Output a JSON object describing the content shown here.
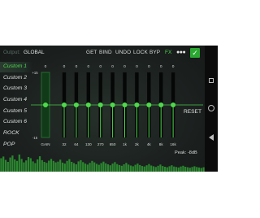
{
  "topbar": {
    "output_label": "Output:",
    "output_value": "GLOBAL",
    "commands": [
      "GET",
      "BIND",
      "UNDO",
      "LOCK",
      "BYP",
      "FX"
    ],
    "more_icon": "more-dots-icon",
    "confirm_icon": "checkmark-icon"
  },
  "presets": [
    "Custom 1",
    "Custom 2",
    "Custom 3",
    "Custom 4",
    "Custom 5",
    "Custom 6",
    "ROCK",
    "POP"
  ],
  "active_preset": "Custom 1",
  "eq": {
    "scale_top": "+15",
    "scale_bottom": "-15",
    "gain": {
      "label": "GAIN",
      "value": "0",
      "level": 0
    },
    "bands": [
      {
        "freq": "32",
        "value": "0",
        "level": 0
      },
      {
        "freq": "64",
        "value": "0",
        "level": 0
      },
      {
        "freq": "130",
        "value": "0",
        "level": 0
      },
      {
        "freq": "270",
        "value": "0",
        "level": 0
      },
      {
        "freq": "650",
        "value": "0",
        "level": 0
      },
      {
        "freq": "1k",
        "value": "0",
        "level": 0
      },
      {
        "freq": "2k",
        "value": "0",
        "level": 0
      },
      {
        "freq": "4k",
        "value": "0",
        "level": 0
      },
      {
        "freq": "8k",
        "value": "0",
        "level": 0
      },
      {
        "freq": "16k",
        "value": "0",
        "level": 0
      }
    ],
    "reset_label": "RESET",
    "peak_text": "Peak: -8dB"
  },
  "colors": {
    "accent": "#4fd84c",
    "spectrum": "#2f9a34",
    "background": "#1c2120"
  },
  "spectrum_levels": [
    0.55,
    0.62,
    0.48,
    0.4,
    0.58,
    0.66,
    0.5,
    0.44,
    0.7,
    0.52,
    0.38,
    0.46,
    0.6,
    0.55,
    0.42,
    0.35,
    0.5,
    0.63,
    0.47,
    0.4,
    0.36,
    0.45,
    0.52,
    0.44,
    0.38,
    0.41,
    0.49,
    0.37,
    0.33,
    0.44,
    0.51,
    0.4,
    0.35,
    0.3,
    0.42,
    0.47,
    0.39,
    0.33,
    0.29,
    0.36,
    0.44,
    0.38,
    0.32,
    0.28,
    0.35,
    0.41,
    0.34,
    0.3,
    0.26,
    0.33,
    0.39,
    0.31,
    0.27,
    0.24,
    0.3,
    0.36,
    0.29,
    0.25,
    0.22,
    0.28,
    0.33,
    0.27,
    0.23,
    0.21,
    0.26,
    0.31,
    0.25,
    0.22,
    0.19,
    0.24,
    0.29,
    0.23,
    0.2,
    0.18,
    0.22,
    0.26,
    0.21,
    0.19,
    0.17,
    0.21,
    0.24,
    0.2,
    0.18,
    0.16,
    0.19,
    0.22,
    0.19,
    0.17,
    0.15,
    0.18
  ]
}
